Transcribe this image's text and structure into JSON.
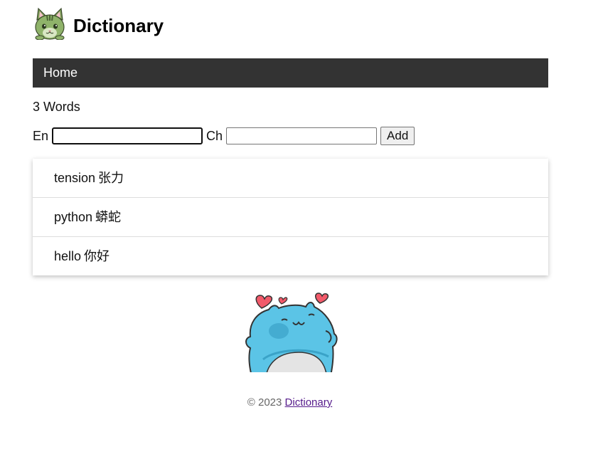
{
  "header": {
    "title": "Dictionary",
    "logo": "cat-logo"
  },
  "nav": {
    "home_label": "Home"
  },
  "summary": {
    "count": "3",
    "unit": "Words"
  },
  "form": {
    "en_label": "En",
    "en_value": "",
    "ch_label": "Ch",
    "ch_value": "",
    "add_label": "Add"
  },
  "words": [
    {
      "en": "tension",
      "ch": "张力"
    },
    {
      "en": "python",
      "ch": "蟒蛇"
    },
    {
      "en": "hello",
      "ch": "你好"
    }
  ],
  "mascot": {
    "icon": "blue-cat-hearts-icon",
    "colors": {
      "body": "#5bc4e6",
      "belly": "#e6e6e6",
      "heart": "#f25a6a"
    }
  },
  "footer": {
    "copyright": "© 2023",
    "link_label": "Dictionary"
  }
}
